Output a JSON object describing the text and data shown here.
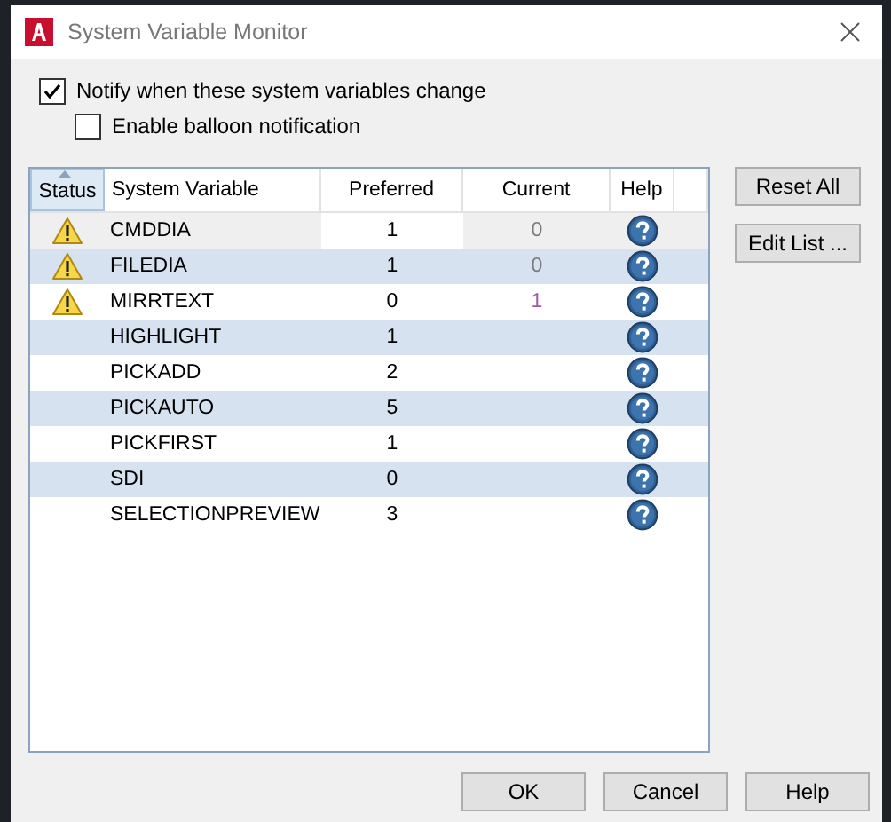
{
  "window": {
    "title": "System Variable Monitor"
  },
  "options": [
    {
      "label": "Notify when these system variables change",
      "checked": true,
      "indent": false
    },
    {
      "label": "Enable balloon notification",
      "checked": false,
      "indent": true
    }
  ],
  "table": {
    "columns": [
      "Status",
      "System Variable",
      "Preferred",
      "Current",
      "Help"
    ],
    "rows": [
      {
        "warning": true,
        "name": "CMDDIA",
        "preferred": "1",
        "current": "0",
        "color": "#7a7a7a",
        "selected": true
      },
      {
        "warning": true,
        "name": "FILEDIA",
        "preferred": "1",
        "current": "0",
        "color": "#7a7a7a",
        "selected": false
      },
      {
        "warning": true,
        "name": "MIRRTEXT",
        "preferred": "0",
        "current": "1",
        "color": "#a05aa8",
        "selected": false
      },
      {
        "warning": false,
        "name": "HIGHLIGHT",
        "preferred": "1",
        "selected": false
      },
      {
        "warning": false,
        "name": "PICKADD",
        "preferred": "2",
        "selected": false
      },
      {
        "warning": false,
        "name": "PICKAUTO",
        "preferred": "5",
        "selected": false
      },
      {
        "warning": false,
        "name": "PICKFIRST",
        "preferred": "1",
        "selected": false
      },
      {
        "warning": false,
        "name": "SDI",
        "preferred": "0",
        "selected": false
      },
      {
        "warning": false,
        "name": "SELECTIONPREVIEW",
        "preferred": "3",
        "selected": false
      }
    ]
  },
  "side_buttons": [
    "Reset All",
    "Edit List ..."
  ],
  "buttons": [
    "OK",
    "Cancel",
    "Help"
  ]
}
